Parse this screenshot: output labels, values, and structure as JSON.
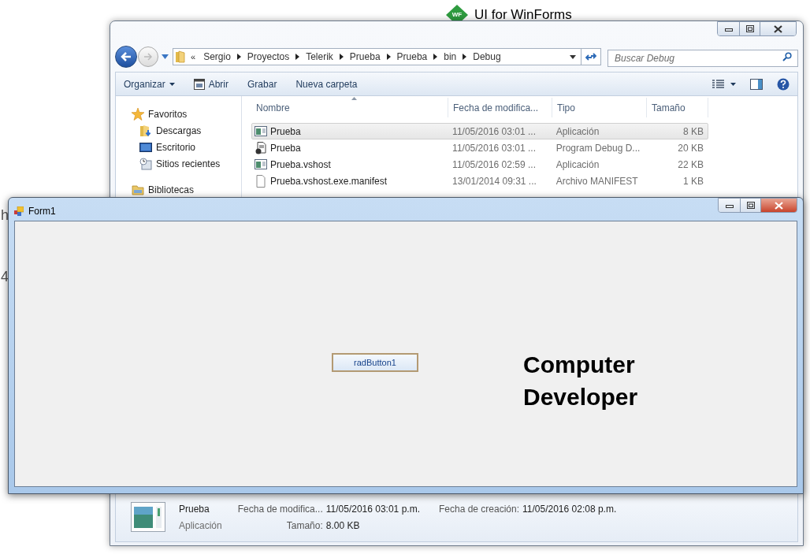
{
  "background": {
    "texts": [
      "h",
      "4"
    ]
  },
  "banner": {
    "logo": "WF",
    "title": "UI for WinForms"
  },
  "explorer": {
    "breadcrumb_prefix": "«",
    "path": [
      "Sergio",
      "Proyectos",
      "Telerik",
      "Prueba",
      "Prueba",
      "bin",
      "Debug"
    ],
    "search": {
      "placeholder": "Buscar Debug"
    },
    "toolbar": [
      {
        "label": "Organizar",
        "kind": "menu"
      },
      {
        "label": "Abrir",
        "kind": "icon"
      },
      {
        "label": "Grabar",
        "kind": "plain"
      },
      {
        "label": "Nueva carpeta",
        "kind": "plain"
      }
    ],
    "nav": [
      {
        "label": "Favoritos",
        "kind": "star",
        "children": [
          {
            "label": "Descargas",
            "kind": "downloads"
          },
          {
            "label": "Escritorio",
            "kind": "desktop"
          },
          {
            "label": "Sitios recientes",
            "kind": "recent"
          }
        ]
      },
      {
        "label": "Bibliotecas",
        "kind": "library"
      }
    ],
    "columns": [
      "Nombre",
      "Fecha de modifica...",
      "Tipo",
      "Tamaño"
    ],
    "rows": [
      {
        "kind": "app",
        "name": "Prueba",
        "date": "11/05/2016 03:01 ...",
        "type": "Aplicación",
        "size": "8 KB",
        "selected": true
      },
      {
        "kind": "debug",
        "name": "Prueba",
        "date": "11/05/2016 03:01 ...",
        "type": "Program Debug D...",
        "size": "20 KB",
        "selected": false
      },
      {
        "kind": "app",
        "name": "Prueba.vshost",
        "date": "11/05/2016 02:59 ...",
        "type": "Aplicación",
        "size": "22 KB",
        "selected": false
      },
      {
        "kind": "file",
        "name": "Prueba.vshost.exe.manifest",
        "date": "13/01/2014 09:31 ...",
        "type": "Archivo MANIFEST",
        "size": "1 KB",
        "selected": false
      }
    ],
    "details": {
      "name": "Prueba",
      "type": "Aplicación",
      "fields": [
        {
          "label": "Fecha de modifica...",
          "value": "11/05/2016 03:01 p.m."
        },
        {
          "label": "Fecha de creación:",
          "value": "11/05/2016 02:08 p.m."
        },
        {
          "label": "Tamaño:",
          "value": "8.00 KB"
        }
      ]
    }
  },
  "form": {
    "title": "Form1",
    "button": "radButton1",
    "caption": "Computer Developer"
  }
}
